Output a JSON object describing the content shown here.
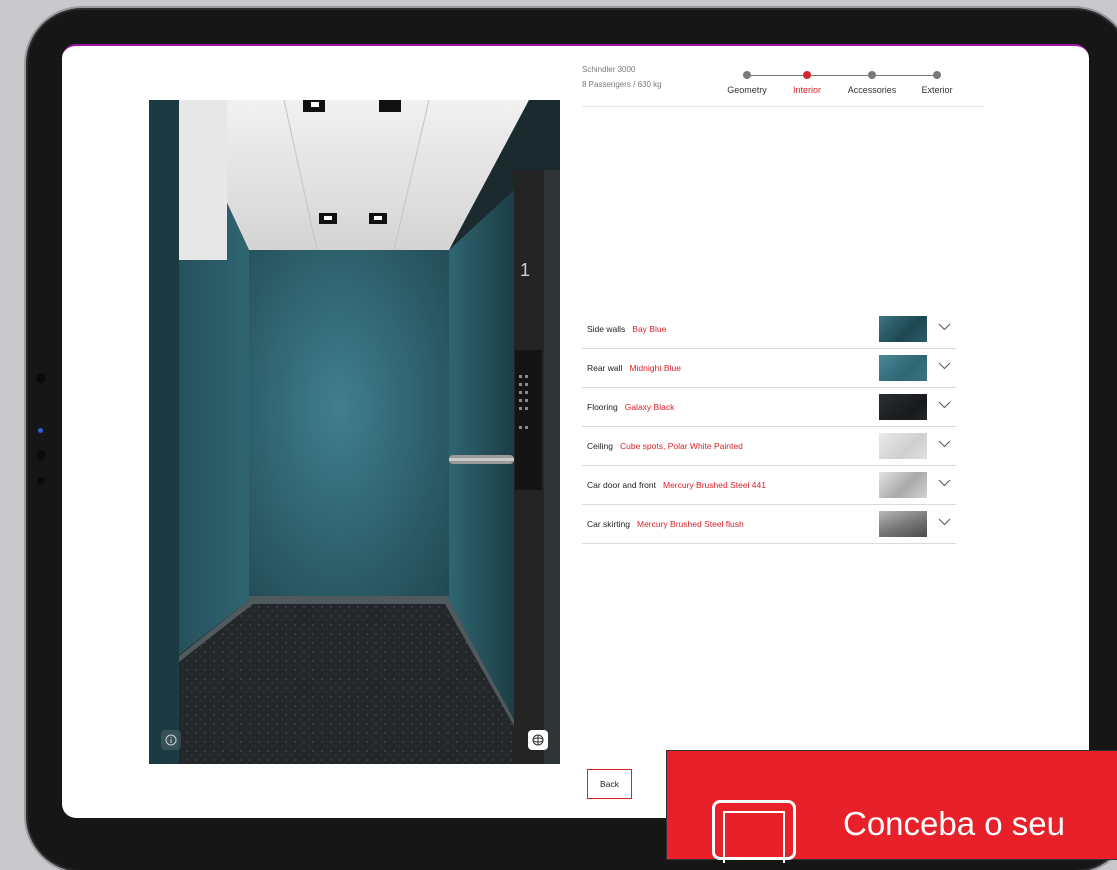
{
  "product": {
    "name": "Schindler 3000",
    "capacity": "8 Passengers / 630 kg"
  },
  "steps": [
    {
      "label": "Geometry",
      "active": false
    },
    {
      "label": "Interior",
      "active": true
    },
    {
      "label": "Accessories",
      "active": false
    },
    {
      "label": "Exterior",
      "active": false
    }
  ],
  "options": [
    {
      "name": "Side walls",
      "value": "Bay Blue",
      "swatch": "#2e5a66",
      "expand_icon": "chevron-down-icon"
    },
    {
      "name": "Rear wall",
      "value": "Midnight Blue",
      "swatch": "#35717f",
      "expand_icon": "chevron-down-icon"
    },
    {
      "name": "Flooring",
      "value": "Galaxy Black",
      "swatch": "#1f2326",
      "expand_icon": "chevron-down-icon"
    },
    {
      "name": "Ceiling",
      "value": "Cube spots, Polar White Painted",
      "swatch": "#d9d9d9",
      "expand_icon": "chevron-down-icon"
    },
    {
      "name": "Car door and front",
      "value": "Mercury Brushed Steel 441",
      "swatch": "#bdbdbd",
      "expand_icon": "chevron-down-icon"
    },
    {
      "name": "Car skirting",
      "value": "Mercury Brushed Steel flush",
      "swatch": "#8e8e8e",
      "expand_icon": "chevron-down-icon"
    }
  ],
  "preview": {
    "floor_indicator": "1",
    "info_icon": "info-icon",
    "rotate_icon": "rotate-3d-icon"
  },
  "actions": {
    "back_label": "Back"
  },
  "promo": {
    "text": "Conceba o seu",
    "icon": "tablet-icon"
  },
  "colors": {
    "accent": "#d8232a",
    "promo_bg": "#e8202a",
    "screen_border": "#a0139c"
  }
}
